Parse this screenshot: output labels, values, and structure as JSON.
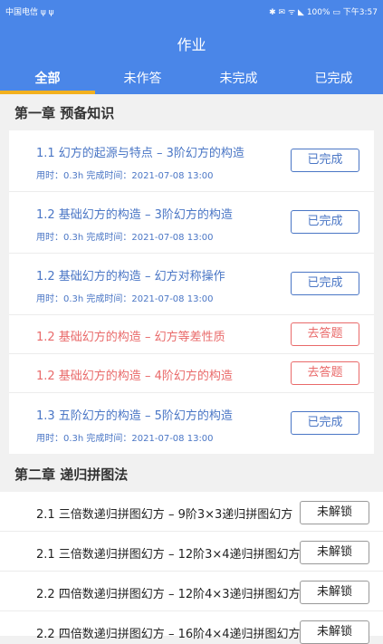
{
  "status_bar": {
    "carrier": "中国电信 ψ ψ",
    "right": "✱ ✉ ᯤ ◣ 100% ▭ 下午3:57"
  },
  "header": {
    "title": "作业"
  },
  "tabs": [
    {
      "label": "全部",
      "active": true
    },
    {
      "label": "未作答",
      "active": false
    },
    {
      "label": "未完成",
      "active": false
    },
    {
      "label": "已完成",
      "active": false
    }
  ],
  "chapters": [
    {
      "title": "第一章  预备知识",
      "items": [
        {
          "title": "1.1 幻方的起源与特点 – 3阶幻方的构造",
          "meta": "用时：0.3h   完成时间：2021-07-08 13:00",
          "button": "已完成",
          "status": "done"
        },
        {
          "title": "1.2 基础幻方的构造 – 3阶幻方的构造",
          "meta": "用时：0.3h   完成时间：2021-07-08 13:00",
          "button": "已完成",
          "status": "done"
        },
        {
          "title": "1.2 基础幻方的构造 – 幻方对称操作",
          "meta": "用时：0.3h   完成时间：2021-07-08 13:00",
          "button": "已完成",
          "status": "done"
        },
        {
          "title": "1.2 基础幻方的构造 – 幻方等差性质",
          "meta": "",
          "button": "去答题",
          "status": "todo"
        },
        {
          "title": "1.2 基础幻方的构造 – 4阶幻方的构造",
          "meta": "",
          "button": "去答题",
          "status": "todo"
        },
        {
          "title": "1.3 五阶幻方的构造 – 5阶幻方的构造",
          "meta": "用时：0.3h   完成时间：2021-07-08 13:00",
          "button": "已完成",
          "status": "done"
        }
      ]
    },
    {
      "title": "第二章  递归拼图法",
      "items": [
        {
          "title": "2.1 三倍数递归拼图幻方 – 9阶3×3递归拼图幻方",
          "button": "未解锁"
        },
        {
          "title": "2.1 三倍数递归拼图幻方 – 12阶3×4递归拼图幻方",
          "button": "未解锁"
        },
        {
          "title": "2.2 四倍数递归拼图幻方 – 12阶4×3递归拼图幻方",
          "button": "未解锁"
        },
        {
          "title": "2.2 四倍数递归拼图幻方 – 16阶4×4递归拼图幻方",
          "button": "未解锁"
        }
      ]
    }
  ],
  "colors": {
    "header": "#4a86e8",
    "accent": "#f2b01e",
    "done": "#4a76c5",
    "todo": "#e96a6a"
  }
}
